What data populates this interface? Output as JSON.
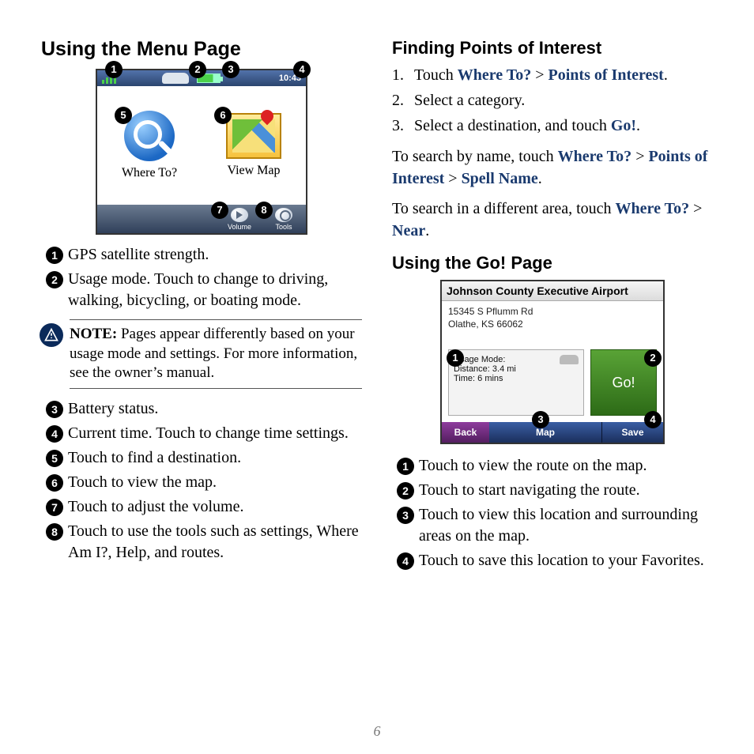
{
  "page_number": "6",
  "left": {
    "heading": "Using the Menu Page",
    "menu_screen": {
      "time": "10:43",
      "where_to_label": "Where To?",
      "view_map_label": "View Map",
      "volume_label": "Volume",
      "tools_label": "Tools"
    },
    "callouts": [
      "➊",
      "➋",
      "➌",
      "➍",
      "➎",
      "➏",
      "➐",
      "➑"
    ],
    "items": [
      "GPS satellite strength.",
      "Usage mode. Touch to change to driving, walking, bicycling, or boating mode."
    ],
    "note_label": "NOTE:",
    "note_text": " Pages appear differently based on your usage mode and settings. For more information, see the owner’s manual.",
    "items2": [
      "Battery status.",
      "Current time. Touch to change time settings.",
      "Touch to find a destination.",
      "Touch to view the map.",
      "Touch to adjust the volume.",
      "Touch to use the tools such as settings, Where Am I?, Help, and routes."
    ]
  },
  "right": {
    "poi_heading": "Finding Points of Interest",
    "poi_steps_pre": [
      "Touch ",
      "Where To?",
      " > ",
      "Points of Interest",
      "."
    ],
    "poi_step2": "Select a category.",
    "poi_step3_pre": "Select a destination, and touch ",
    "poi_step3_link": "Go!",
    "poi_step3_post": ".",
    "search_name_pre": "To search by name, touch ",
    "search_name_links": [
      "Where To?",
      " > ",
      "Points of Interest",
      " > ",
      "Spell Name"
    ],
    "search_name_post": ".",
    "search_area_pre": "To search in a different area, touch ",
    "search_area_links": [
      "Where To?",
      " > ",
      "Near"
    ],
    "search_area_post": ".",
    "go_heading": "Using the Go! Page",
    "go_screen": {
      "title": "Johnson County Executive Airport",
      "addr1": "15345 S Pflumm Rd",
      "addr2": "Olathe, KS 66062",
      "usage": "Usage Mode:",
      "distance": "Distance: 3.4 mi",
      "time": "Time: 6 mins",
      "go": "Go!",
      "back": "Back",
      "map": "Map",
      "save": "Save"
    },
    "go_items": [
      "Touch to view the route on the map.",
      "Touch to start navigating the route.",
      "Touch to view this location and surrounding areas on the map.",
      "Touch to save this location to your Favorites."
    ]
  }
}
